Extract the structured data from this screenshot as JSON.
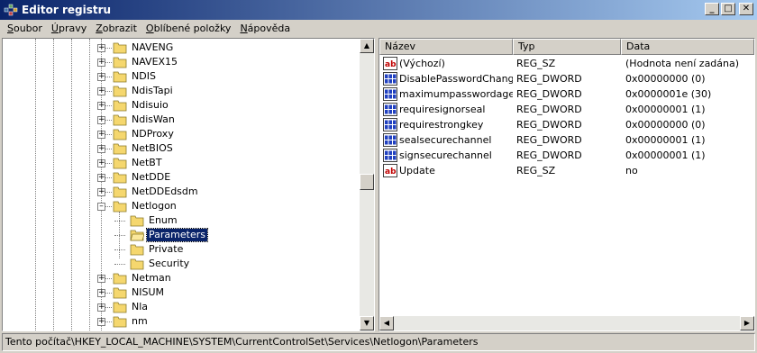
{
  "window": {
    "title": "Editor registru",
    "minimize_label": "_",
    "maximize_label": "□",
    "close_label": "✕"
  },
  "menu": [
    {
      "label": "Soubor",
      "accel": "S",
      "rest": "oubor"
    },
    {
      "label": "Úpravy",
      "accel": "Ú",
      "rest": "pravy"
    },
    {
      "label": "Zobrazit",
      "accel": "Z",
      "rest": "obrazit"
    },
    {
      "label": "Oblíbené položky",
      "accel": "O",
      "rest": "blíbené položky"
    },
    {
      "label": "Nápověda",
      "accel": "N",
      "rest": "ápověda"
    }
  ],
  "tree": {
    "nodes": [
      {
        "label": "NAVENG",
        "level": 0,
        "expander": "+"
      },
      {
        "label": "NAVEX15",
        "level": 0,
        "expander": "+"
      },
      {
        "label": "NDIS",
        "level": 0,
        "expander": "+"
      },
      {
        "label": "NdisTapi",
        "level": 0,
        "expander": "+"
      },
      {
        "label": "Ndisuio",
        "level": 0,
        "expander": "+"
      },
      {
        "label": "NdisWan",
        "level": 0,
        "expander": "+"
      },
      {
        "label": "NDProxy",
        "level": 0,
        "expander": "+"
      },
      {
        "label": "NetBIOS",
        "level": 0,
        "expander": "+"
      },
      {
        "label": "NetBT",
        "level": 0,
        "expander": "+"
      },
      {
        "label": "NetDDE",
        "level": 0,
        "expander": "+"
      },
      {
        "label": "NetDDEdsdm",
        "level": 0,
        "expander": "+"
      },
      {
        "label": "Netlogon",
        "level": 0,
        "expander": "-"
      },
      {
        "label": "Enum",
        "level": 1,
        "expander": ""
      },
      {
        "label": "Parameters",
        "level": 1,
        "expander": "",
        "selected": true
      },
      {
        "label": "Private",
        "level": 1,
        "expander": ""
      },
      {
        "label": "Security",
        "level": 1,
        "expander": ""
      },
      {
        "label": "Netman",
        "level": 0,
        "expander": "+"
      },
      {
        "label": "NISUM",
        "level": 0,
        "expander": "+"
      },
      {
        "label": "Nla",
        "level": 0,
        "expander": "+"
      },
      {
        "label": "nm",
        "level": 0,
        "expander": "+"
      }
    ]
  },
  "list": {
    "columns": {
      "name": "Název",
      "type": "Typ",
      "data": "Data"
    },
    "rows": [
      {
        "icon": "string-value-icon",
        "name": "(Výchozí)",
        "type": "REG_SZ",
        "data": "(Hodnota není zadána)"
      },
      {
        "icon": "binary-value-icon",
        "name": "DisablePasswordChange",
        "type": "REG_DWORD",
        "data": "0x00000000 (0)"
      },
      {
        "icon": "binary-value-icon",
        "name": "maximumpasswordage",
        "type": "REG_DWORD",
        "data": "0x0000001e (30)"
      },
      {
        "icon": "binary-value-icon",
        "name": "requiresignorseal",
        "type": "REG_DWORD",
        "data": "0x00000001 (1)"
      },
      {
        "icon": "binary-value-icon",
        "name": "requirestrongkey",
        "type": "REG_DWORD",
        "data": "0x00000000 (0)"
      },
      {
        "icon": "binary-value-icon",
        "name": "sealsecurechannel",
        "type": "REG_DWORD",
        "data": "0x00000001 (1)"
      },
      {
        "icon": "binary-value-icon",
        "name": "signsecurechannel",
        "type": "REG_DWORD",
        "data": "0x00000001 (1)"
      },
      {
        "icon": "string-value-icon",
        "name": "Update",
        "type": "REG_SZ",
        "data": "no"
      }
    ]
  },
  "status": {
    "path": "Tento počítač\\HKEY_LOCAL_MACHINE\\SYSTEM\\CurrentControlSet\\Services\\Netlogon\\Parameters"
  },
  "colors": {
    "title_start": "#0a246a",
    "title_end": "#a6caf0",
    "selection": "#0a246a",
    "face": "#d4d0c8",
    "folder": "#f5d76e"
  }
}
